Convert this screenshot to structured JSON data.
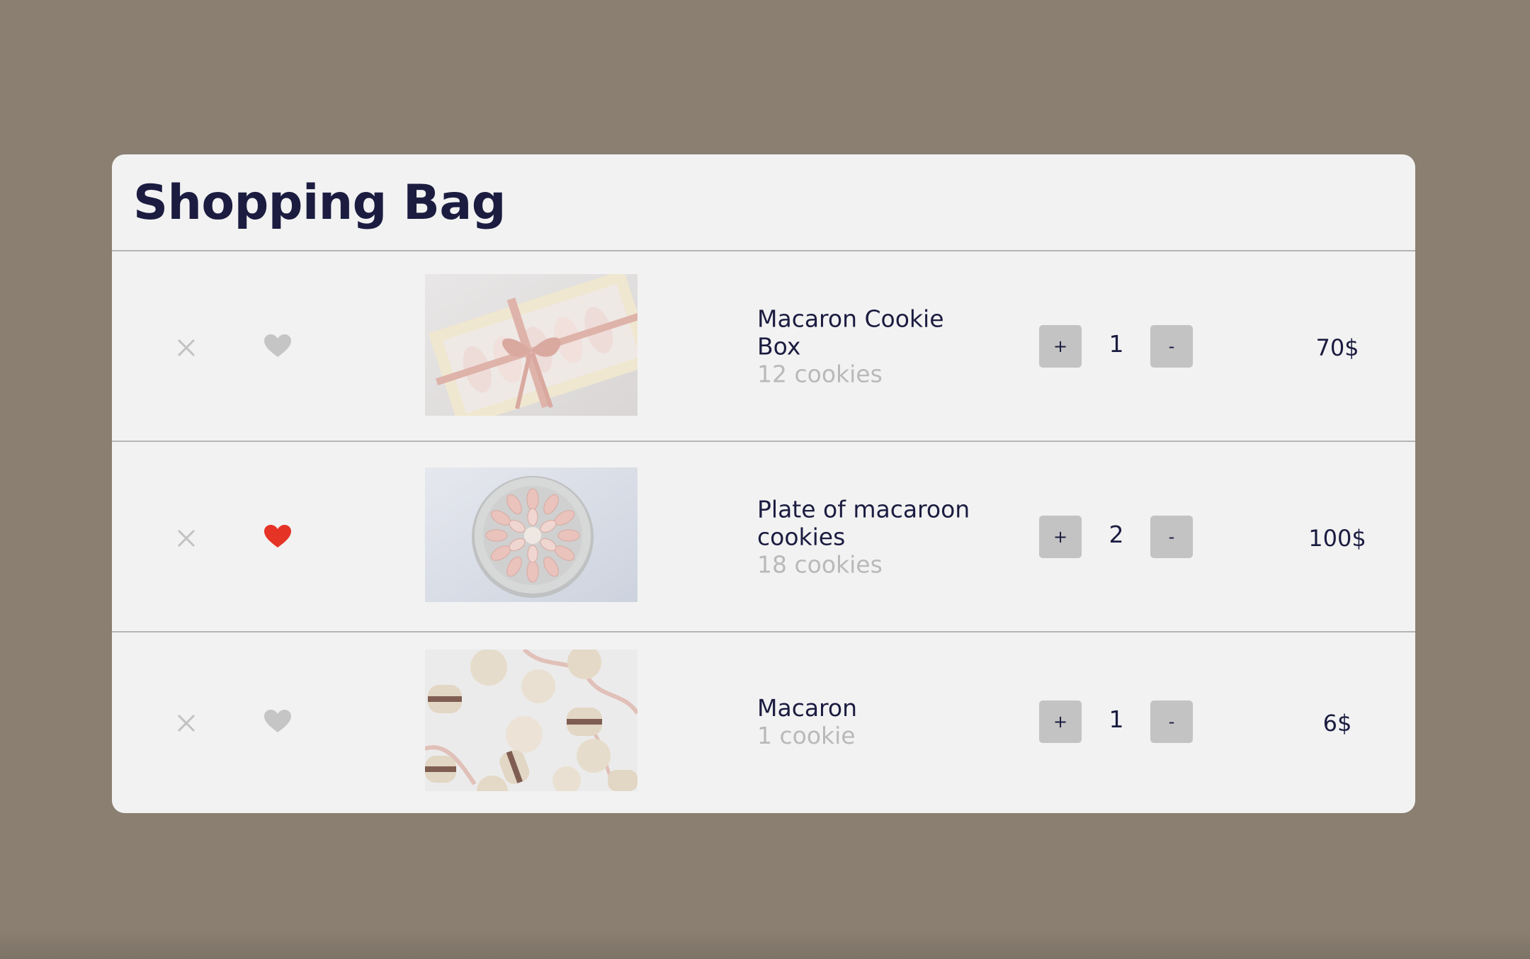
{
  "bag": {
    "title": "Shopping Bag",
    "items": [
      {
        "name": "Macaron Cookie Box",
        "description": "12 cookies",
        "quantity": "1",
        "price": "70$",
        "liked": false,
        "image_icon": "macaron-box-photo"
      },
      {
        "name": "Plate of macaroon cookies",
        "description": "18 cookies",
        "quantity": "2",
        "price": "100$",
        "liked": true,
        "image_icon": "macaron-plate-photo"
      },
      {
        "name": "Macaron",
        "description": "1 cookie",
        "quantity": "1",
        "price": "6$",
        "liked": false,
        "image_icon": "scattered-macarons-photo"
      }
    ],
    "controls": {
      "plus_label": "+",
      "minus_label": "-"
    }
  },
  "icons": {
    "remove": "close-icon",
    "like": "heart-icon"
  },
  "colors": {
    "background": "#8a7f71",
    "card": "#f2f2f2",
    "title": "#1b1c40",
    "muted": "#b9b9b9",
    "heart_inactive": "#c5c5c5",
    "heart_active": "#e53326",
    "qty_button": "#c3c3c3"
  }
}
